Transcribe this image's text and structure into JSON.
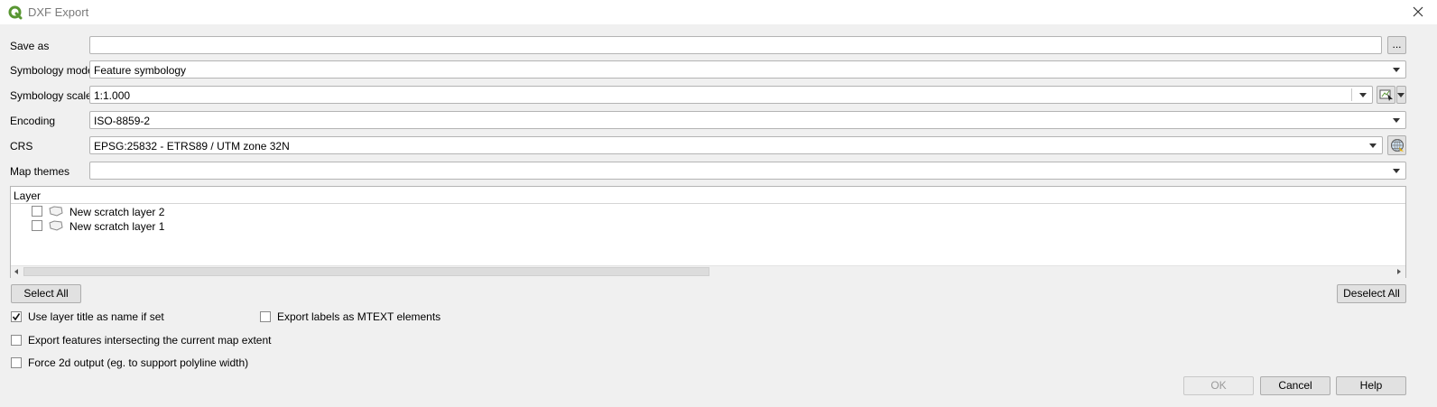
{
  "window": {
    "title": "DXF Export",
    "icon": "qgis-icon",
    "close_icon": "close-icon"
  },
  "form": {
    "save_as": {
      "label": "Save as",
      "value": "",
      "browse_label": "..."
    },
    "symbology_mode": {
      "label": "Symbology mode",
      "value": "Feature symbology"
    },
    "symbology_scale": {
      "label": "Symbology scale",
      "value": "1:1.000"
    },
    "encoding": {
      "label": "Encoding",
      "value": "ISO-8859-2"
    },
    "crs": {
      "label": "CRS",
      "value": "EPSG:25832 - ETRS89 / UTM zone 32N"
    },
    "map_themes": {
      "label": "Map themes",
      "value": ""
    }
  },
  "layers": {
    "header": "Layer",
    "items": [
      {
        "label": "New scratch layer 2",
        "checked": false,
        "icon": "polygon-layer-icon"
      },
      {
        "label": "New scratch layer 1",
        "checked": false,
        "icon": "polygon-layer-icon"
      }
    ]
  },
  "buttons": {
    "select_all": "Select All",
    "deselect_all": "Deselect All",
    "ok": "OK",
    "cancel": "Cancel",
    "help": "Help"
  },
  "options": {
    "use_layer_title": {
      "label": "Use layer title as name if set",
      "checked": true
    },
    "export_labels_mtext": {
      "label": "Export labels as MTEXT elements",
      "checked": false
    },
    "export_intersecting": {
      "label": "Export features intersecting the current map extent",
      "checked": false
    },
    "force_2d": {
      "label": "Force 2d output (eg. to support polyline width)",
      "checked": false
    }
  },
  "colors": {
    "background": "#f0f0f0",
    "qgis_green": "#589632",
    "field_border": "#b4b4b4",
    "disabled_text": "#9a9a9a"
  }
}
